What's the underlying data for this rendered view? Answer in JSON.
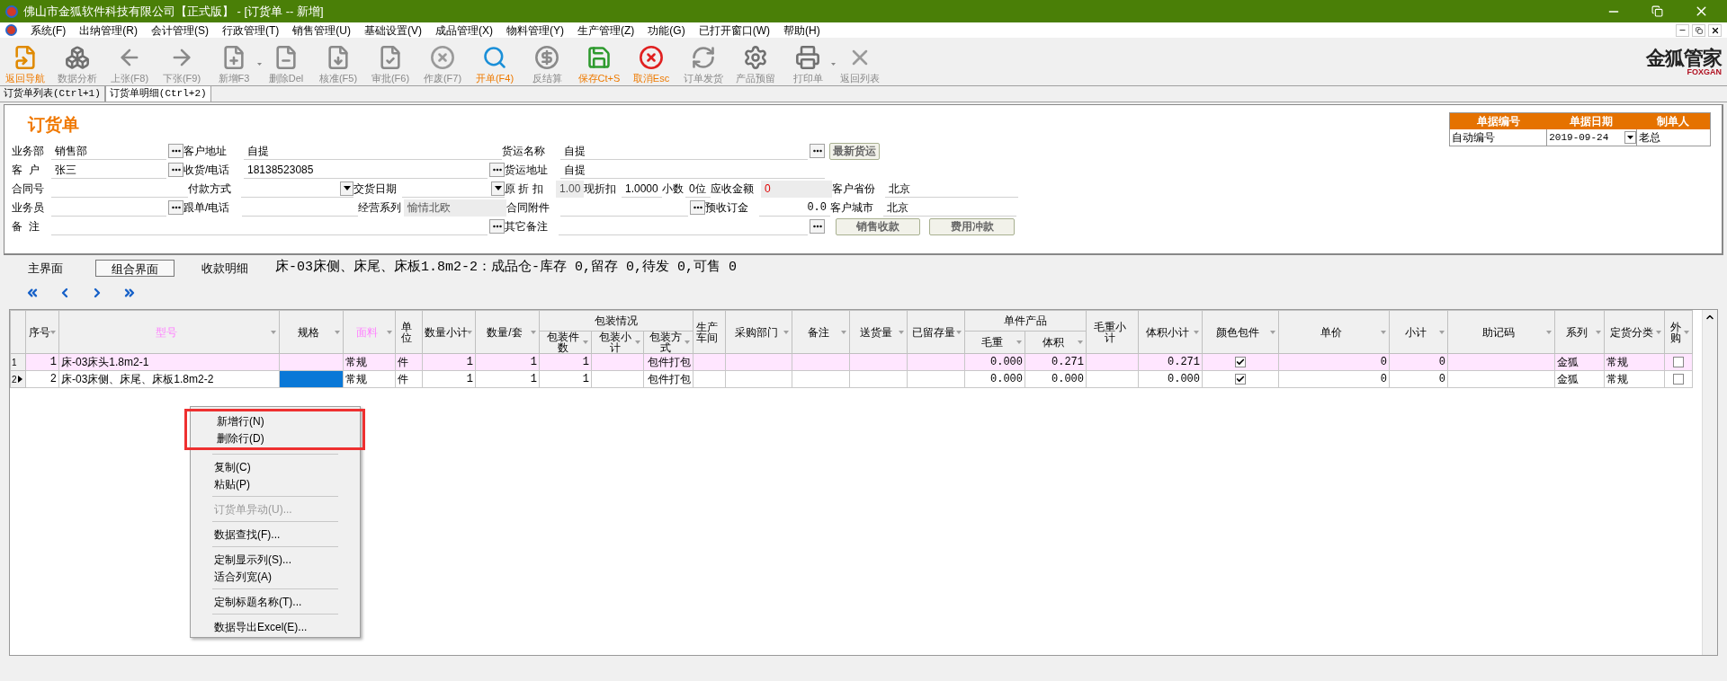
{
  "window": {
    "title": "佛山市金狐软件科技有限公司【正式版】 - [订货单 -- 新增]"
  },
  "menu": [
    "系统(F)",
    "出纳管理(R)",
    "会计管理(S)",
    "行政管理(T)",
    "销售管理(U)",
    "基础设置(V)",
    "成品管理(X)",
    "物料管理(Y)",
    "生产管理(Z)",
    "功能(G)",
    "已打开窗口(W)",
    "帮助(H)"
  ],
  "toolbar": [
    {
      "label": "返回导航",
      "emphasized": true,
      "dropdown": false
    },
    {
      "label": "数据分析",
      "emphasized": false,
      "dropdown": false
    },
    {
      "label": "上张(F8)",
      "emphasized": false,
      "dropdown": false
    },
    {
      "label": "下张(F9)",
      "emphasized": false,
      "dropdown": false
    },
    {
      "label": "新增F3",
      "emphasized": false,
      "dropdown": true
    },
    {
      "label": "删除Del",
      "emphasized": false,
      "dropdown": false
    },
    {
      "label": "核准(F5)",
      "emphasized": false,
      "dropdown": false
    },
    {
      "label": "审批(F6)",
      "emphasized": false,
      "dropdown": false
    },
    {
      "label": "作废(F7)",
      "emphasized": false,
      "dropdown": false
    },
    {
      "label": "开单(F4)",
      "emphasized": true,
      "dropdown": false
    },
    {
      "label": "反结算",
      "emphasized": false,
      "dropdown": false
    },
    {
      "label": "保存Ct+S",
      "emphasized": true,
      "dropdown": false
    },
    {
      "label": "取消Esc",
      "emphasized": true,
      "dropdown": false
    },
    {
      "label": "订单发货",
      "emphasized": false,
      "dropdown": false
    },
    {
      "label": "产品预留",
      "emphasized": false,
      "dropdown": false
    },
    {
      "label": "打印单",
      "emphasized": false,
      "dropdown": true
    },
    {
      "label": "返回列表",
      "emphasized": false,
      "dropdown": false
    }
  ],
  "logo": {
    "name": "金狐管家",
    "subtitle": "FOXGAN"
  },
  "doc_tabs": [
    {
      "label": "订货单列表(Ctrl+1)",
      "selected": false
    },
    {
      "label": "订货单明细(Ctrl+2)",
      "selected": true
    }
  ],
  "form": {
    "title": "订货单",
    "info_table": {
      "columns": [
        "单据编号",
        "单据日期",
        "制单人"
      ],
      "values": [
        "自动编号",
        "2019-09-24",
        "老总"
      ]
    },
    "lines": [
      {
        "fields": [
          {
            "label": "业务部",
            "kind": "lookup",
            "value": "销售部"
          },
          {
            "label": "客户地址",
            "kind": "text",
            "value": "自提"
          },
          {
            "label": "货运名称",
            "kind": "lookup",
            "value": "自提"
          }
        ],
        "buttons": [
          "最新货运"
        ]
      },
      {
        "fields": [
          {
            "label": "客  户",
            "kind": "lookup",
            "value": "张三"
          },
          {
            "label": "收货/电话",
            "kind": "lookup",
            "value": "18138523085"
          },
          {
            "label": "货运地址",
            "kind": "text",
            "value": "自提"
          }
        ]
      },
      {
        "fields": [
          {
            "label": "合同号",
            "kind": "text"
          },
          {
            "label": "付款方式",
            "kind": "select"
          },
          {
            "label": "交货日期",
            "kind": "select"
          },
          {
            "label": "原 折 扣",
            "kind": "readonly",
            "value": "1.00"
          },
          {
            "label": "现折扣",
            "kind": "text",
            "value": "1.0000"
          },
          {
            "label": "小数",
            "kind": "text",
            "value": "0位"
          },
          {
            "label": "应收金额",
            "kind": "amount",
            "value": "0"
          },
          {
            "label": "客户省份",
            "kind": "text",
            "value": "北京"
          }
        ]
      },
      {
        "fields": [
          {
            "label": "业务员",
            "kind": "lookup"
          },
          {
            "label": "跟单/电话",
            "kind": "text"
          },
          {
            "label": "经营系列",
            "kind": "readonly",
            "value": "愉情北欧"
          },
          {
            "label": "合同附件",
            "kind": "lookup"
          },
          {
            "label": "预收订金",
            "kind": "number",
            "value": "0.0"
          },
          {
            "label": "客户城市",
            "kind": "text",
            "value": "北京"
          }
        ]
      },
      {
        "fields": [
          {
            "label": "备  注",
            "kind": "lookup"
          },
          {
            "label": "其它备注",
            "kind": "lookup"
          }
        ],
        "buttons": [
          "销售收款",
          "费用冲款"
        ]
      }
    ]
  },
  "view_tabs": [
    {
      "label": "主界面",
      "selected": false
    },
    {
      "label": "组合界面",
      "selected": true
    },
    {
      "label": "收款明细",
      "selected": false
    }
  ],
  "stock_status": "床-03床侧、床尾、床板1.8m2-2：成品仓-库存 0,留存 0,待发 0,可售 0",
  "grid": {
    "columns": [
      {
        "label": "序号",
        "kind": "number",
        "highlight": false,
        "filter": true
      },
      {
        "label": "型号",
        "kind": "text",
        "highlight": true,
        "filter": true
      },
      {
        "label": "规格",
        "kind": "text",
        "highlight": false,
        "filter": true
      },
      {
        "label": "面料",
        "kind": "text",
        "highlight": true,
        "filter": true
      },
      {
        "label": "单位",
        "kind": "text",
        "highlight": false,
        "filter": false
      },
      {
        "label": "数量小计",
        "kind": "number",
        "highlight": false,
        "filter": true
      },
      {
        "label": "数量/套",
        "kind": "number",
        "highlight": false,
        "filter": true
      },
      {
        "label": "包装情况",
        "colspan": 3,
        "children": [
          {
            "label": "包装件数",
            "kind": "number",
            "highlight": false,
            "filter": true
          },
          {
            "label": "包装小计",
            "kind": "number",
            "highlight": false,
            "filter": true
          },
          {
            "label": "包装方式",
            "kind": "clip",
            "highlight": false,
            "filter": true
          }
        ]
      },
      {
        "label": "生产车间",
        "kind": "text",
        "highlight": false,
        "filter": false
      },
      {
        "label": "采购部门",
        "kind": "text",
        "highlight": false,
        "filter": true
      },
      {
        "label": "备注",
        "kind": "text",
        "highlight": false,
        "filter": true
      },
      {
        "label": "送货量",
        "kind": "number",
        "highlight": false,
        "filter": true
      },
      {
        "label": "已留存量",
        "kind": "number",
        "highlight": false,
        "filter": true
      },
      {
        "label": "单件产品",
        "colspan": 2,
        "children": [
          {
            "label": "毛重",
            "kind": "number",
            "highlight": false,
            "filter": true
          },
          {
            "label": "体积",
            "kind": "number",
            "highlight": false,
            "filter": true
          }
        ]
      },
      {
        "label": "毛重小计",
        "kind": "number",
        "highlight": false,
        "filter": false
      },
      {
        "label": "体积小计",
        "kind": "number",
        "highlight": false,
        "filter": true
      },
      {
        "label": "颜色包件",
        "kind": "check",
        "highlight": false,
        "filter": true
      },
      {
        "label": "单价",
        "kind": "number",
        "highlight": false,
        "filter": true
      },
      {
        "label": "小计",
        "kind": "number",
        "highlight": false,
        "filter": true
      },
      {
        "label": "助记码",
        "kind": "text",
        "highlight": false,
        "filter": true
      },
      {
        "label": "系列",
        "kind": "text",
        "highlight": false,
        "filter": true
      },
      {
        "label": "定货分类",
        "kind": "text",
        "highlight": false,
        "filter": true
      },
      {
        "label": "外购",
        "kind": "check",
        "highlight": false,
        "filter": true
      }
    ],
    "rows": [
      {
        "number": "1",
        "current": false,
        "highlighted": true,
        "cells": [
          "1",
          "床-03床头1.8m2-1",
          null,
          "常规",
          "件",
          "1",
          "1",
          "1",
          null,
          "包件打包",
          null,
          null,
          null,
          null,
          null,
          "0.000",
          "0.271",
          null,
          "0.271",
          true,
          "0",
          "0",
          null,
          "金狐",
          "常规",
          false
        ]
      },
      {
        "number": "2",
        "current": true,
        "highlighted": false,
        "cells": [
          "2",
          "床-03床侧、床尾、床板1.8m2-2",
          {
            "focused": true
          },
          "常规",
          "件",
          "1",
          "1",
          "1",
          null,
          "包件打包",
          null,
          null,
          null,
          null,
          null,
          "0.000",
          "0.000",
          null,
          "0.000",
          true,
          "0",
          "0",
          null,
          "金狐",
          "常规",
          false
        ]
      }
    ]
  },
  "context_menu": {
    "groups": [
      {
        "highlighted": true,
        "items": [
          {
            "label": "新增行(N)",
            "disabled": false
          },
          {
            "label": "删除行(D)",
            "disabled": false
          }
        ]
      },
      {
        "highlighted": false,
        "items": [
          {
            "label": "复制(C)",
            "disabled": false
          },
          {
            "label": "粘贴(P)",
            "disabled": false
          }
        ]
      },
      {
        "highlighted": false,
        "items": [
          {
            "label": "订货单异动(U)...",
            "disabled": true
          }
        ]
      },
      {
        "highlighted": false,
        "items": [
          {
            "label": "数据查找(F)...",
            "disabled": false
          }
        ]
      },
      {
        "highlighted": false,
        "items": [
          {
            "label": "定制显示列(S)...",
            "disabled": false
          },
          {
            "label": "适合列宽(A)",
            "disabled": false
          }
        ]
      },
      {
        "highlighted": false,
        "items": [
          {
            "label": "定制标题名称(T)...",
            "disabled": false
          }
        ]
      },
      {
        "highlighted": false,
        "items": [
          {
            "label": "数据导出Excel(E)...",
            "disabled": false
          }
        ]
      }
    ]
  }
}
